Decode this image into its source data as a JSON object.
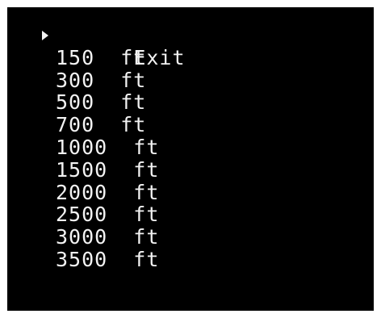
{
  "menu": {
    "selected_index": 0,
    "items": [
      {
        "label": "Exit"
      },
      {
        "label": "150  ft"
      },
      {
        "label": "300  ft"
      },
      {
        "label": "500  ft"
      },
      {
        "label": "700  ft"
      },
      {
        "label": "1000  ft"
      },
      {
        "label": "1500  ft"
      },
      {
        "label": "2000  ft"
      },
      {
        "label": "2500  ft"
      },
      {
        "label": "3000  ft"
      },
      {
        "label": "3500  ft"
      }
    ],
    "icons": {
      "cursor": "triangle-right-icon"
    },
    "colors": {
      "background": "#000000",
      "text": "#f2f2f2",
      "frame": "#ffffff"
    }
  }
}
